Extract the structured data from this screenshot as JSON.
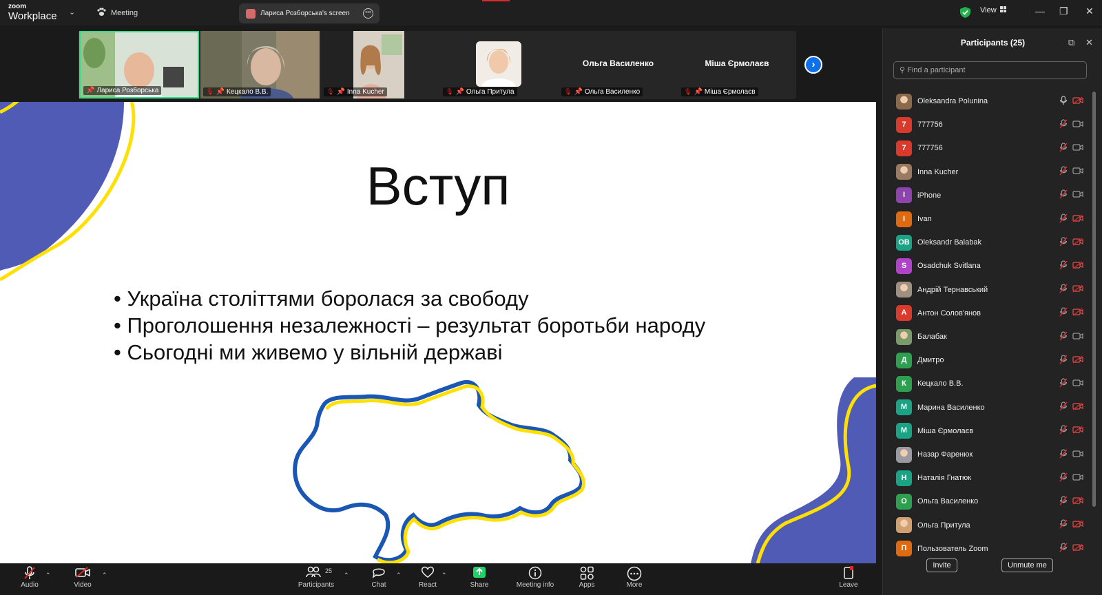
{
  "app": {
    "brand_top": "zoom",
    "brand_bottom": "Workplace",
    "meeting_label": "Meeting",
    "screen_tab_label": "Лариса Розборська's screen",
    "view_label": "View"
  },
  "gallery": {
    "tiles": [
      {
        "name": "Лариса Розборська"
      },
      {
        "name": "Кецкало В.В."
      },
      {
        "name": "Inna Kucher"
      },
      {
        "name": "Ольга Притула"
      },
      {
        "name": "Ольга Василенко",
        "big_name": "Ольга Василенко"
      },
      {
        "name": "Міша Єрмолаєв",
        "big_name": "Міша Єрмолаєв"
      }
    ]
  },
  "slide": {
    "title": "Вступ",
    "bullets": [
      "• Україна століттями боролася за свободу",
      "• Проголошення незалежності – результат боротьби народу",
      "• Сьогодні ми живемо у вільній державі"
    ],
    "colors": {
      "blue": "#4f5bb5",
      "yellow": "#ffe000",
      "map_blue": "#1a56b4"
    }
  },
  "toolbar": {
    "audio": "Audio",
    "video": "Video",
    "participants": "Participants",
    "participants_count": "25",
    "chat": "Chat",
    "react": "React",
    "share": "Share",
    "meeting_info": "Meeting info",
    "apps": "Apps",
    "more": "More",
    "leave": "Leave"
  },
  "participants_panel": {
    "title": "Participants (25)",
    "search_placeholder": "Find a participant",
    "invite": "Invite",
    "unmute_me": "Unmute me",
    "list": [
      {
        "name": "Oleksandra Polunina",
        "initial": "",
        "color": "#8a6a4a",
        "photo": true,
        "mic_muted": false,
        "video_off": true
      },
      {
        "name": "777756",
        "initial": "7",
        "color": "#d93a2b",
        "photo": false,
        "mic_muted": true,
        "video_off": false
      },
      {
        "name": "777756",
        "initial": "7",
        "color": "#d93a2b",
        "photo": false,
        "mic_muted": true,
        "video_off": false
      },
      {
        "name": "Inna Kucher",
        "initial": "",
        "color": "#9a7a60",
        "photo": true,
        "mic_muted": true,
        "video_off": false
      },
      {
        "name": "iPhone",
        "initial": "I",
        "color": "#8e44ad",
        "photo": false,
        "mic_muted": true,
        "video_off": false
      },
      {
        "name": "Ivan",
        "initial": "I",
        "color": "#e06a10",
        "photo": false,
        "mic_muted": true,
        "video_off": true
      },
      {
        "name": "Oleksandr Balabak",
        "initial": "OB",
        "color": "#1aa385",
        "photo": false,
        "mic_muted": true,
        "video_off": true
      },
      {
        "name": "Osadchuk Svitlana",
        "initial": "S",
        "color": "#b044c9",
        "photo": false,
        "mic_muted": true,
        "video_off": true
      },
      {
        "name": "Андрій Тернавський",
        "initial": "",
        "color": "#a09080",
        "photo": true,
        "mic_muted": true,
        "video_off": true
      },
      {
        "name": "Антон Солов'янов",
        "initial": "А",
        "color": "#d93a2b",
        "photo": false,
        "mic_muted": true,
        "video_off": true
      },
      {
        "name": "Балабак",
        "initial": "",
        "color": "#7a9a6a",
        "photo": true,
        "mic_muted": true,
        "video_off": false
      },
      {
        "name": "Дмитро",
        "initial": "Д",
        "color": "#2e9e4f",
        "photo": false,
        "mic_muted": true,
        "video_off": true
      },
      {
        "name": "Кецкало В.В.",
        "initial": "К",
        "color": "#2e9e4f",
        "photo": false,
        "mic_muted": true,
        "video_off": false
      },
      {
        "name": "Марина Василенко",
        "initial": "М",
        "color": "#1aa385",
        "photo": false,
        "mic_muted": true,
        "video_off": true
      },
      {
        "name": "Міша Єрмолаєв",
        "initial": "М",
        "color": "#1aa385",
        "photo": false,
        "mic_muted": true,
        "video_off": true
      },
      {
        "name": "Назар Фаренюк",
        "initial": "",
        "color": "#9a9aa0",
        "photo": true,
        "mic_muted": true,
        "video_off": false
      },
      {
        "name": "Наталія Гнатюк",
        "initial": "Н",
        "color": "#1aa385",
        "photo": false,
        "mic_muted": true,
        "video_off": false
      },
      {
        "name": "Ольга Василенко",
        "initial": "О",
        "color": "#2e9e4f",
        "photo": false,
        "mic_muted": true,
        "video_off": true
      },
      {
        "name": "Ольга Притула",
        "initial": "",
        "color": "#d0a070",
        "photo": true,
        "mic_muted": true,
        "video_off": true
      },
      {
        "name": "Пользователь Zoom",
        "initial": "П",
        "color": "#e06a10",
        "photo": false,
        "mic_muted": true,
        "video_off": true
      }
    ]
  }
}
